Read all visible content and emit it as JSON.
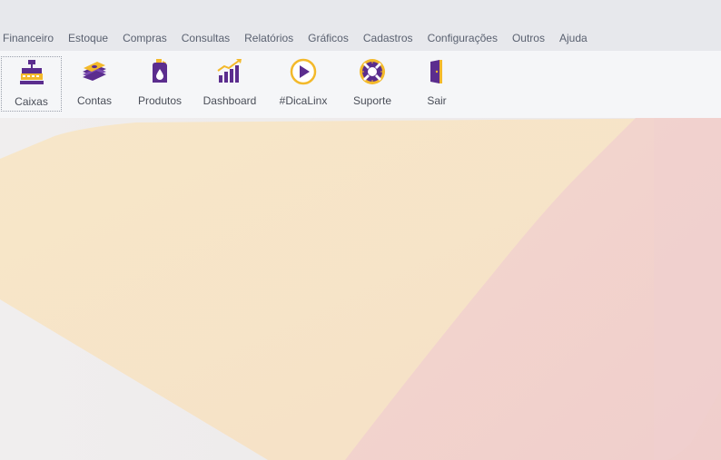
{
  "menu": [
    "Financeiro",
    "Estoque",
    "Compras",
    "Consultas",
    "Relatórios",
    "Gráficos",
    "Cadastros",
    "Configurações",
    "Outros",
    "Ajuda"
  ],
  "toolbar": {
    "caixas": {
      "label": "Caixas",
      "icon": "cash-register-icon"
    },
    "contas": {
      "label": "Contas",
      "icon": "money-stack-icon"
    },
    "produtos": {
      "label": "Produtos",
      "icon": "product-bottle-icon"
    },
    "dashboard": {
      "label": "Dashboard",
      "icon": "chart-growth-icon"
    },
    "dicalinx": {
      "label": "#DicaLinx",
      "icon": "play-icon"
    },
    "suporte": {
      "label": "Suporte",
      "icon": "lifebuoy-icon"
    },
    "sair": {
      "label": "Sair",
      "icon": "exit-door-icon"
    }
  },
  "colors": {
    "purple": "#5b2d8e",
    "gold": "#f3b92b",
    "canvas_peach": "#f6e4c8",
    "canvas_pink": "#f2d0d0"
  }
}
